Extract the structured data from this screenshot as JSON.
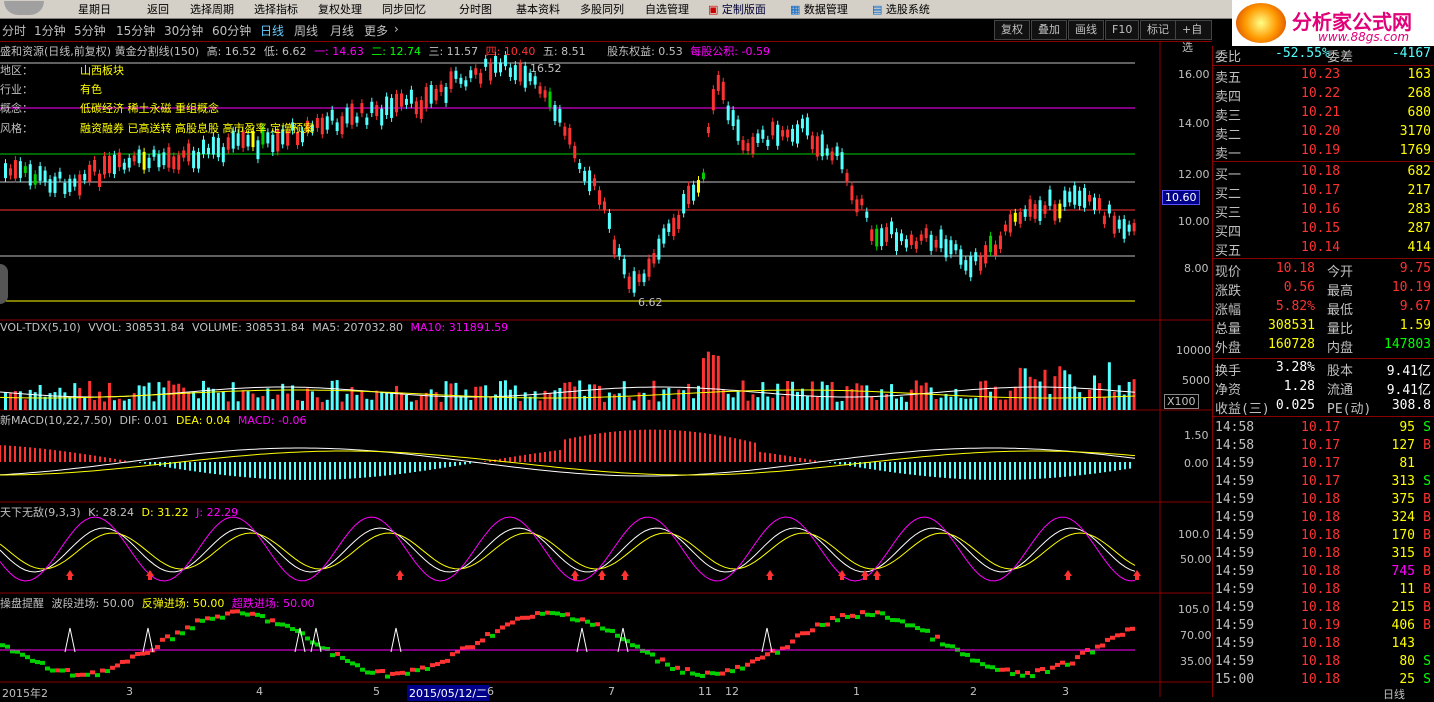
{
  "menu": {
    "weekday": "星期日",
    "items": [
      "返回",
      "选择周期",
      "选择指标",
      "复权处理",
      "同步回忆",
      "分时图",
      "基本资料",
      "多股同列",
      "自选管理",
      "定制版面",
      "数据管理",
      "选股系统"
    ]
  },
  "logo": {
    "title": "分析家公式网",
    "url": "www.88gs.com"
  },
  "periods": [
    "分时",
    "1分钟",
    "5分钟",
    "15分钟",
    "30分钟",
    "60分钟",
    "日线",
    "周线",
    "月线",
    "更多"
  ],
  "active_period": "日线",
  "right_buttons": [
    "复权",
    "叠加",
    "画线",
    "F10",
    "标记",
    "+自选"
  ],
  "main_panel": {
    "title": "盛和资源(日线,前复权) 黄金分割线(150)",
    "stats": [
      "高: 16.52",
      "低: 6.62",
      "一: 14.63",
      "二: 12.74",
      "三: 11.57",
      "四: 10.40",
      "五: 8.51"
    ],
    "extra": [
      "股东权益: 0.53",
      "每股公积: -0.59"
    ],
    "info_labels": [
      "地区：",
      "行业：",
      "概念：",
      "风格："
    ],
    "info_values": [
      "山西板块",
      "有色",
      "低碳经济 稀土永磁 重组概念",
      "融资融券 已高送转 高股息股 高市盈率 定增预案"
    ],
    "y_labels": [
      "16.00",
      "14.00",
      "12.00",
      "10.00",
      "8.00"
    ],
    "current_price": "10.60",
    "high_mark": "16.52",
    "low_mark": "6.62"
  },
  "vol_panel": {
    "title": "VOL-TDX(5,10)",
    "stats": [
      "VVOL: 308531.84",
      "VOLUME: 308531.84",
      "MA5: 207032.80"
    ],
    "ma10": "MA10: 311891.59",
    "y_labels": [
      "10000",
      "5000"
    ],
    "unit": "X100"
  },
  "macd_panel": {
    "title": "新MACD(10,22,7.50)",
    "stats": [
      "DIF: 0.01",
      "DEA: 0.04"
    ],
    "macd": "MACD: -0.06",
    "y_labels": [
      "1.50",
      "0.00"
    ]
  },
  "kdj_panel": {
    "title": "天下无敌(9,3,3)",
    "stats": [
      "K: 28.24",
      "D: 31.22"
    ],
    "j": "J: 22.29",
    "y_labels": [
      "100.0",
      "50.00"
    ]
  },
  "alert_panel": {
    "title": "操盘提醒",
    "stats": [
      "波段进场: 50.00",
      "反弹进场: 50.00"
    ],
    "super": "超跌进场: 50.00",
    "y_labels": [
      "105.0",
      "70.00",
      "35.00"
    ]
  },
  "date_axis": [
    "2015年2",
    "3",
    "4",
    "5",
    "2015/05/12/二",
    "6",
    "7",
    "11",
    "12",
    "1",
    "2",
    "3"
  ],
  "right_panel": {
    "top_label": "委比",
    "top_val": "-52.55%",
    "top_label2": "委差",
    "top_val2": "-4167",
    "sell": [
      {
        "label": "卖五",
        "price": "10.23",
        "vol": "163"
      },
      {
        "label": "卖四",
        "price": "10.22",
        "vol": "268"
      },
      {
        "label": "卖三",
        "price": "10.21",
        "vol": "680"
      },
      {
        "label": "卖二",
        "price": "10.20",
        "vol": "3170"
      },
      {
        "label": "卖一",
        "price": "10.19",
        "vol": "1769"
      }
    ],
    "buy": [
      {
        "label": "买一",
        "price": "10.18",
        "vol": "682"
      },
      {
        "label": "买二",
        "price": "10.17",
        "vol": "217"
      },
      {
        "label": "买三",
        "price": "10.16",
        "vol": "283"
      },
      {
        "label": "买四",
        "price": "10.15",
        "vol": "287"
      },
      {
        "label": "买五",
        "price": "10.14",
        "vol": "414"
      }
    ],
    "quote": [
      {
        "l1": "现价",
        "v1": "10.18",
        "l2": "今开",
        "v2": "9.75"
      },
      {
        "l1": "涨跌",
        "v1": "0.56",
        "l2": "最高",
        "v2": "10.19"
      },
      {
        "l1": "涨幅",
        "v1": "5.82%",
        "l2": "最低",
        "v2": "9.67"
      },
      {
        "l1": "总量",
        "v1": "308531",
        "l2": "量比",
        "v2": "1.59"
      },
      {
        "l1": "外盘",
        "v1": "160728",
        "l2": "内盘",
        "v2": "147803"
      }
    ],
    "fund": [
      {
        "l1": "换手",
        "v1": "3.28%",
        "l2": "股本",
        "v2": "9.41亿"
      },
      {
        "l1": "净资",
        "v1": "1.28",
        "l2": "流通",
        "v2": "9.41亿"
      },
      {
        "l1": "收益(三)",
        "v1": "0.025",
        "l2": "PE(动)",
        "v2": "308.8"
      }
    ],
    "ticks": [
      {
        "t": "14:58",
        "p": "10.17",
        "v": "95",
        "d": "S"
      },
      {
        "t": "14:58",
        "p": "10.17",
        "v": "127",
        "d": "B"
      },
      {
        "t": "14:59",
        "p": "10.17",
        "v": "81",
        "d": ""
      },
      {
        "t": "14:59",
        "p": "10.17",
        "v": "313",
        "d": "S"
      },
      {
        "t": "14:59",
        "p": "10.18",
        "v": "375",
        "d": "B"
      },
      {
        "t": "14:59",
        "p": "10.18",
        "v": "324",
        "d": "B"
      },
      {
        "t": "14:59",
        "p": "10.18",
        "v": "170",
        "d": "B"
      },
      {
        "t": "14:59",
        "p": "10.18",
        "v": "315",
        "d": "B"
      },
      {
        "t": "14:59",
        "p": "10.18",
        "v": "745",
        "d": "B"
      },
      {
        "t": "14:59",
        "p": "10.18",
        "v": "11",
        "d": "B"
      },
      {
        "t": "14:59",
        "p": "10.18",
        "v": "215",
        "d": "B"
      },
      {
        "t": "14:59",
        "p": "10.19",
        "v": "406",
        "d": "B"
      },
      {
        "t": "14:59",
        "p": "10.18",
        "v": "143",
        "d": ""
      },
      {
        "t": "14:59",
        "p": "10.18",
        "v": "80",
        "d": "S"
      },
      {
        "t": "15:00",
        "p": "10.18",
        "v": "25",
        "d": "S"
      }
    ],
    "bottom_label": "日线"
  },
  "colors": {
    "up": "#ff3232",
    "down": "#54ffff",
    "green": "#00d000",
    "yellow": "#ffff00",
    "magenta": "#ff00ff",
    "grid": "#8b0000"
  }
}
